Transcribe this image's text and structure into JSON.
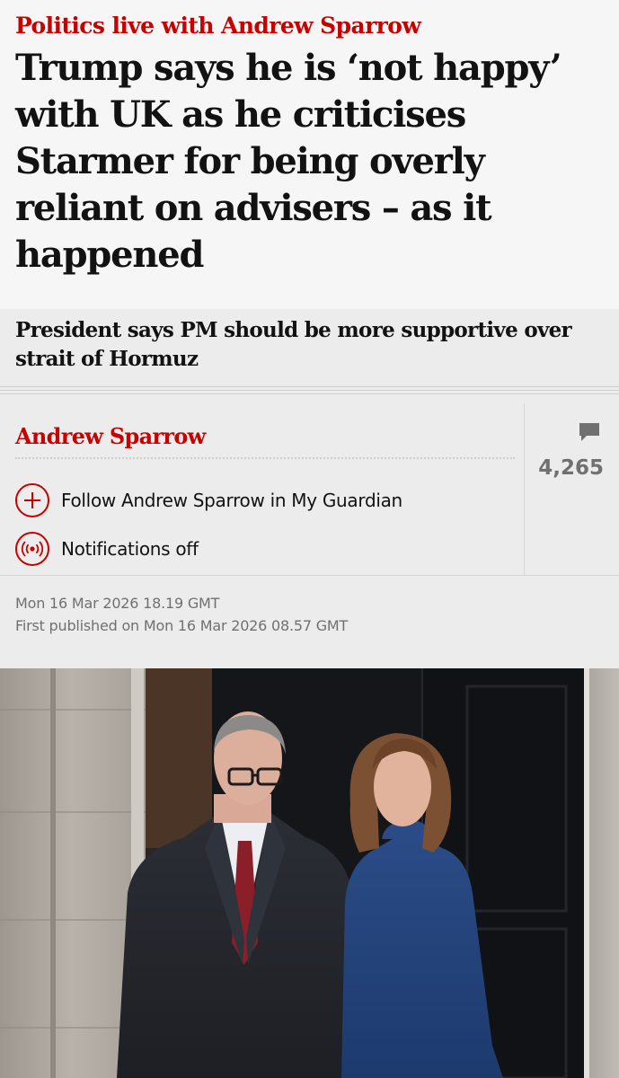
{
  "article": {
    "kicker": "Politics live with Andrew Sparrow",
    "headline": "Trump says he is ‘not happy’ with UK as he criticises Starmer for being overly reliant on advisers – as it happened",
    "standfirst": "President says PM should be more supportive over strait of Hormuz"
  },
  "byline": {
    "author": "Andrew Sparrow",
    "follow_label": "Follow Andrew Sparrow in My Guardian",
    "notifications_label": "Notifications off"
  },
  "comments": {
    "count": "4,265",
    "icon": "comment-icon"
  },
  "dates": {
    "updated": "Mon 16 Mar 2026 18.19 GMT",
    "first_published": "First published on Mon 16 Mar 2026 08.57 GMT"
  },
  "colors": {
    "accent": "#c70000",
    "background": "#f6f6f6",
    "meta_background": "#ececec"
  }
}
